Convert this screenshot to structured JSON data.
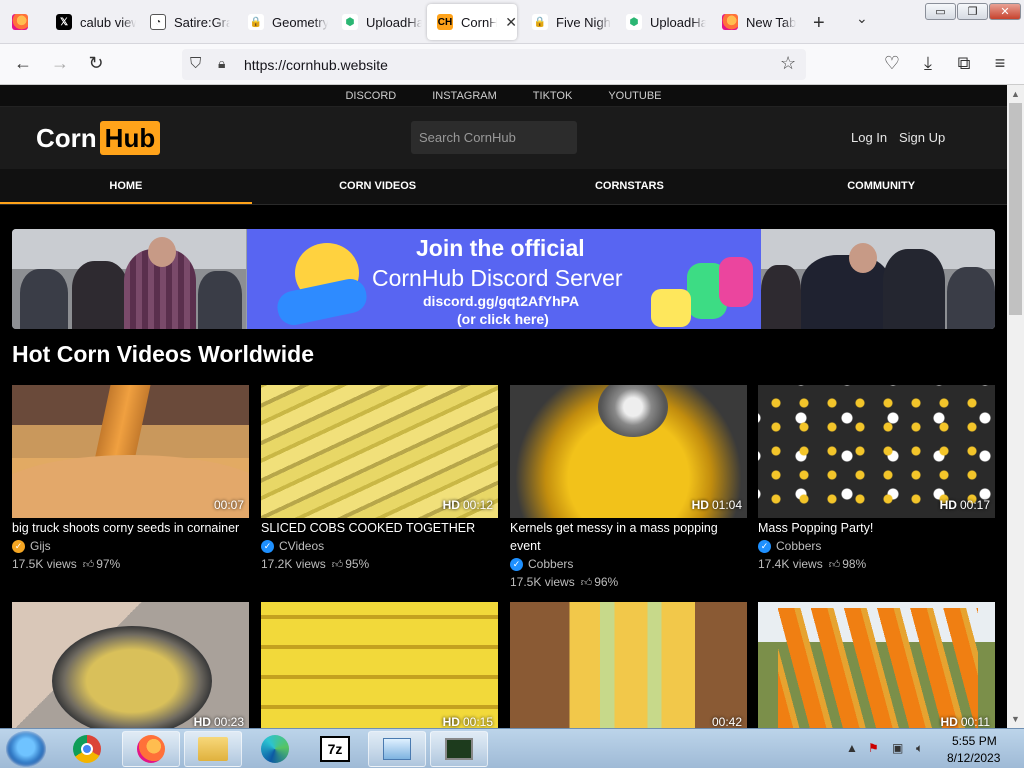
{
  "browser": {
    "tabs": [
      {
        "title": "",
        "icon": "firefox-icon"
      },
      {
        "title": "calub view",
        "icon": "x-logo-icon"
      },
      {
        "title": "Satire:Gra",
        "icon": "satire-icon"
      },
      {
        "title": "Geometry",
        "icon": "geometry-icon"
      },
      {
        "title": "UploadHa",
        "icon": "uploadhaven-icon"
      },
      {
        "title": "CornH",
        "icon": "cornhub-icon",
        "active": true
      },
      {
        "title": "Five Nigh",
        "icon": "fnaf-icon"
      },
      {
        "title": "UploadHa",
        "icon": "uploadhaven-icon"
      },
      {
        "title": "New Tab",
        "icon": "firefox-icon"
      }
    ],
    "favicon_ch": "CH",
    "url": "https://cornhub.website",
    "window_controls": {
      "minimize": "▭",
      "maximize": "❐",
      "close": "✕"
    }
  },
  "site": {
    "top_links": [
      "DISCORD",
      "INSTAGRAM",
      "TIKTOK",
      "YOUTUBE"
    ],
    "logo": {
      "part1": "Corn",
      "part2": "Hub",
      "accent": "#ffa31a"
    },
    "search_placeholder": "Search CornHub",
    "login": "Log In",
    "signup": "Sign Up",
    "nav": [
      "HOME",
      "CORN VIDEOS",
      "CORNSTARS",
      "COMMUNITY"
    ],
    "banner": {
      "line1": "Join the official",
      "line2": "CornHub Discord Server",
      "line3": "discord.gg/gqt2AfYhPA",
      "line4": "(or click here)",
      "bg": "#5865f2"
    },
    "section_title": "Hot Corn Videos Worldwide",
    "videos": [
      {
        "title": "big truck shoots corny seeds in cornainer",
        "channel": "Gijs",
        "badge": "gold",
        "views": "17.5K views",
        "rating": "97%",
        "hd": "",
        "duration": "00:07"
      },
      {
        "title": "SLICED COBS COOKED TOGETHER",
        "channel": "CVideos",
        "badge": "blue",
        "views": "17.2K views",
        "rating": "95%",
        "hd": "HD",
        "duration": "00:12"
      },
      {
        "title": "Kernels get messy in a mass popping event",
        "channel": "Cobbers",
        "badge": "blue",
        "views": "17.5K views",
        "rating": "96%",
        "hd": "HD",
        "duration": "01:04"
      },
      {
        "title": "Mass Popping Party!",
        "channel": "Cobbers",
        "badge": "blue",
        "views": "17.4K views",
        "rating": "98%",
        "hd": "HD",
        "duration": "00:17"
      },
      {
        "hd": "HD",
        "duration": "00:23"
      },
      {
        "hd": "HD",
        "duration": "00:15"
      },
      {
        "hd": "",
        "duration": "00:42"
      },
      {
        "hd": "HD",
        "duration": "00:11"
      }
    ]
  },
  "taskbar": {
    "time": "5:55 PM",
    "date": "8/12/2023",
    "apps": [
      "chrome-icon",
      "firefox-icon",
      "file-explorer-icon",
      "edge-icon",
      "7zip-icon",
      "control-panel-icon",
      "task-manager-icon"
    ],
    "sevenzip_label": "7z"
  }
}
